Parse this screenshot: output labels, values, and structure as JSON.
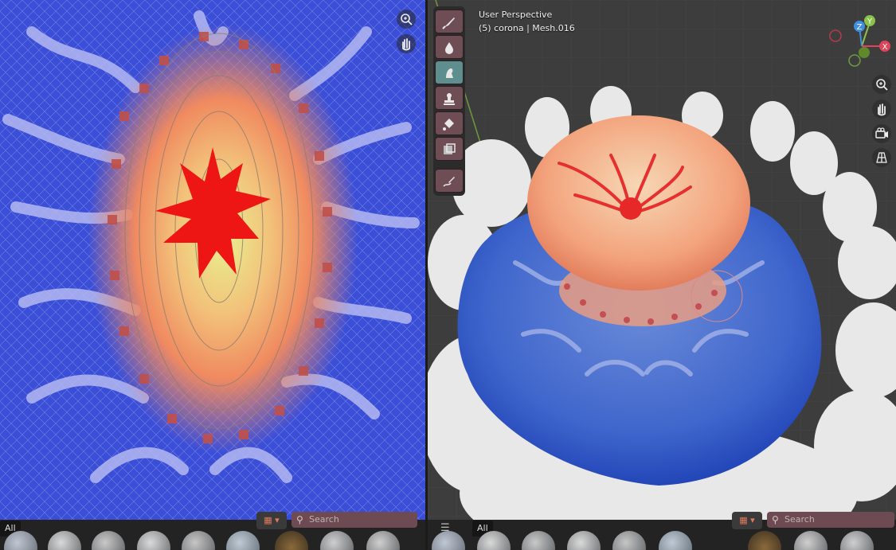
{
  "uv_editor": {
    "footer": {
      "tab_all": "All",
      "search_placeholder": "Search",
      "view_icon": "grid-view-icon"
    },
    "nav_icons": [
      "zoom-icon",
      "pan-hand-icon"
    ]
  },
  "viewport": {
    "hud": {
      "perspective": "User Perspective",
      "object_info": "(5) corona | Mesh.016"
    },
    "gizmo_axes": [
      "Z",
      "Y",
      "X"
    ],
    "nav_icons": [
      "zoom-icon",
      "pan-hand-icon",
      "camera-icon",
      "grid-icon"
    ],
    "tools": [
      "draw-brush-icon",
      "blur-drop-icon",
      "smear-icon",
      "clone-stamp-icon",
      "fill-bucket-icon",
      "mask-icon",
      "annotate-pen-icon"
    ],
    "footer": {
      "tab_all": "All",
      "search_placeholder": "Search",
      "menu_icon": "hamburger-menu-icon",
      "view_icon": "grid-view-icon"
    }
  },
  "colors": {
    "active_tool": "#5f8e8f",
    "tool": "#6f4d54",
    "search_bg": "#6e4b52",
    "gizmo_x": "#e0445a",
    "gizmo_y": "#8bc34a",
    "gizmo_z": "#3f8fe0"
  }
}
